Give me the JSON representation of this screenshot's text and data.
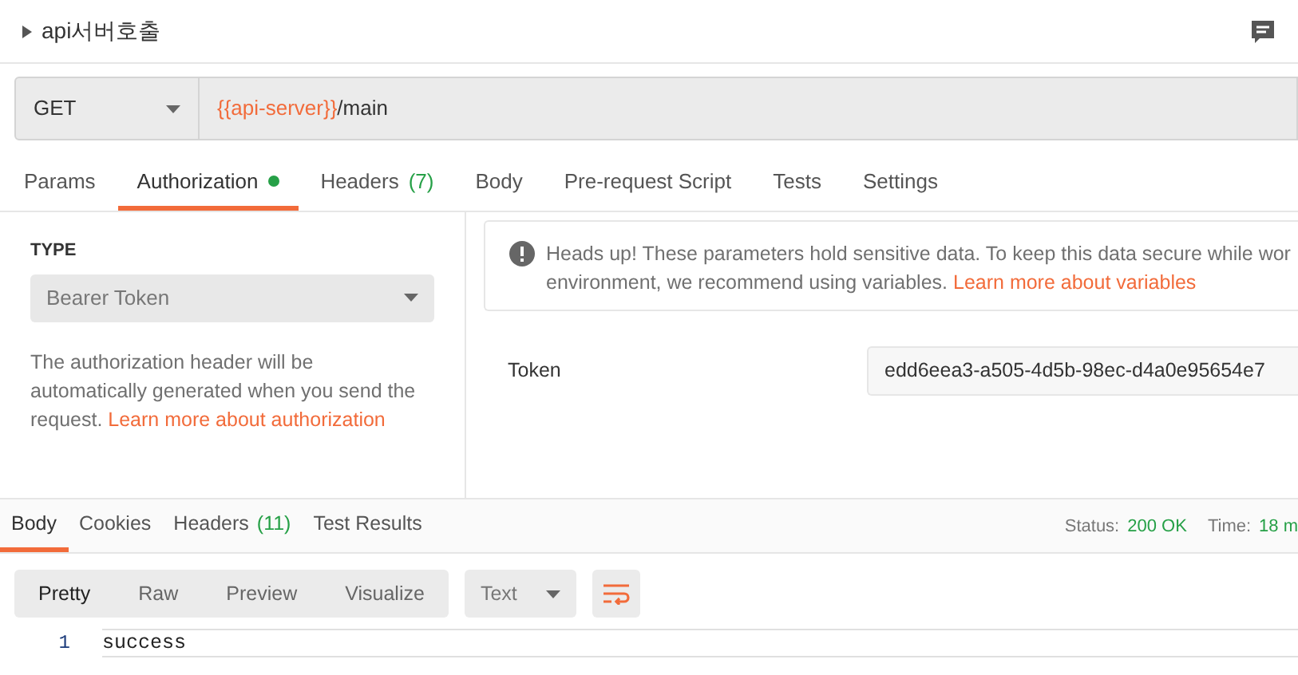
{
  "request": {
    "name": "api서버호출",
    "method": "GET",
    "url_variable": "{{api-server}}",
    "url_path": "/main"
  },
  "request_tabs": [
    {
      "label": "Params",
      "selected": false,
      "indicator": false
    },
    {
      "label": "Authorization",
      "selected": true,
      "indicator": true
    },
    {
      "label": "Headers",
      "count": "(7)",
      "selected": false,
      "indicator": false
    },
    {
      "label": "Body",
      "selected": false,
      "indicator": false
    },
    {
      "label": "Pre-request Script",
      "selected": false,
      "indicator": false
    },
    {
      "label": "Tests",
      "selected": false,
      "indicator": false
    },
    {
      "label": "Settings",
      "selected": false,
      "indicator": false
    }
  ],
  "auth": {
    "type_label": "TYPE",
    "type_value": "Bearer Token",
    "description": "The authorization header will be automatically generated when you send the request.",
    "description_link": "Learn more about authorization",
    "notice": "Heads up! These parameters hold sensitive data. To keep this data secure while wor",
    "notice_line2": "environment, we recommend using variables.",
    "notice_link": "Learn more about variables",
    "token_label": "Token",
    "token_value": "edd6eea3-a505-4d5b-98ec-d4a0e95654e7"
  },
  "response_tabs": [
    {
      "label": "Body",
      "selected": true
    },
    {
      "label": "Cookies",
      "selected": false
    },
    {
      "label": "Headers",
      "count": "(11)",
      "selected": false
    },
    {
      "label": "Test Results",
      "selected": false
    }
  ],
  "status": {
    "status_label": "Status:",
    "status_value": "200 OK",
    "time_label": "Time:",
    "time_value": "18 m"
  },
  "view_modes": [
    {
      "label": "Pretty",
      "selected": true
    },
    {
      "label": "Raw",
      "selected": false
    },
    {
      "label": "Preview",
      "selected": false
    },
    {
      "label": "Visualize",
      "selected": false
    }
  ],
  "format": "Text",
  "wrap_lines": true,
  "response_lines": [
    {
      "number": "1",
      "text": "success"
    }
  ]
}
